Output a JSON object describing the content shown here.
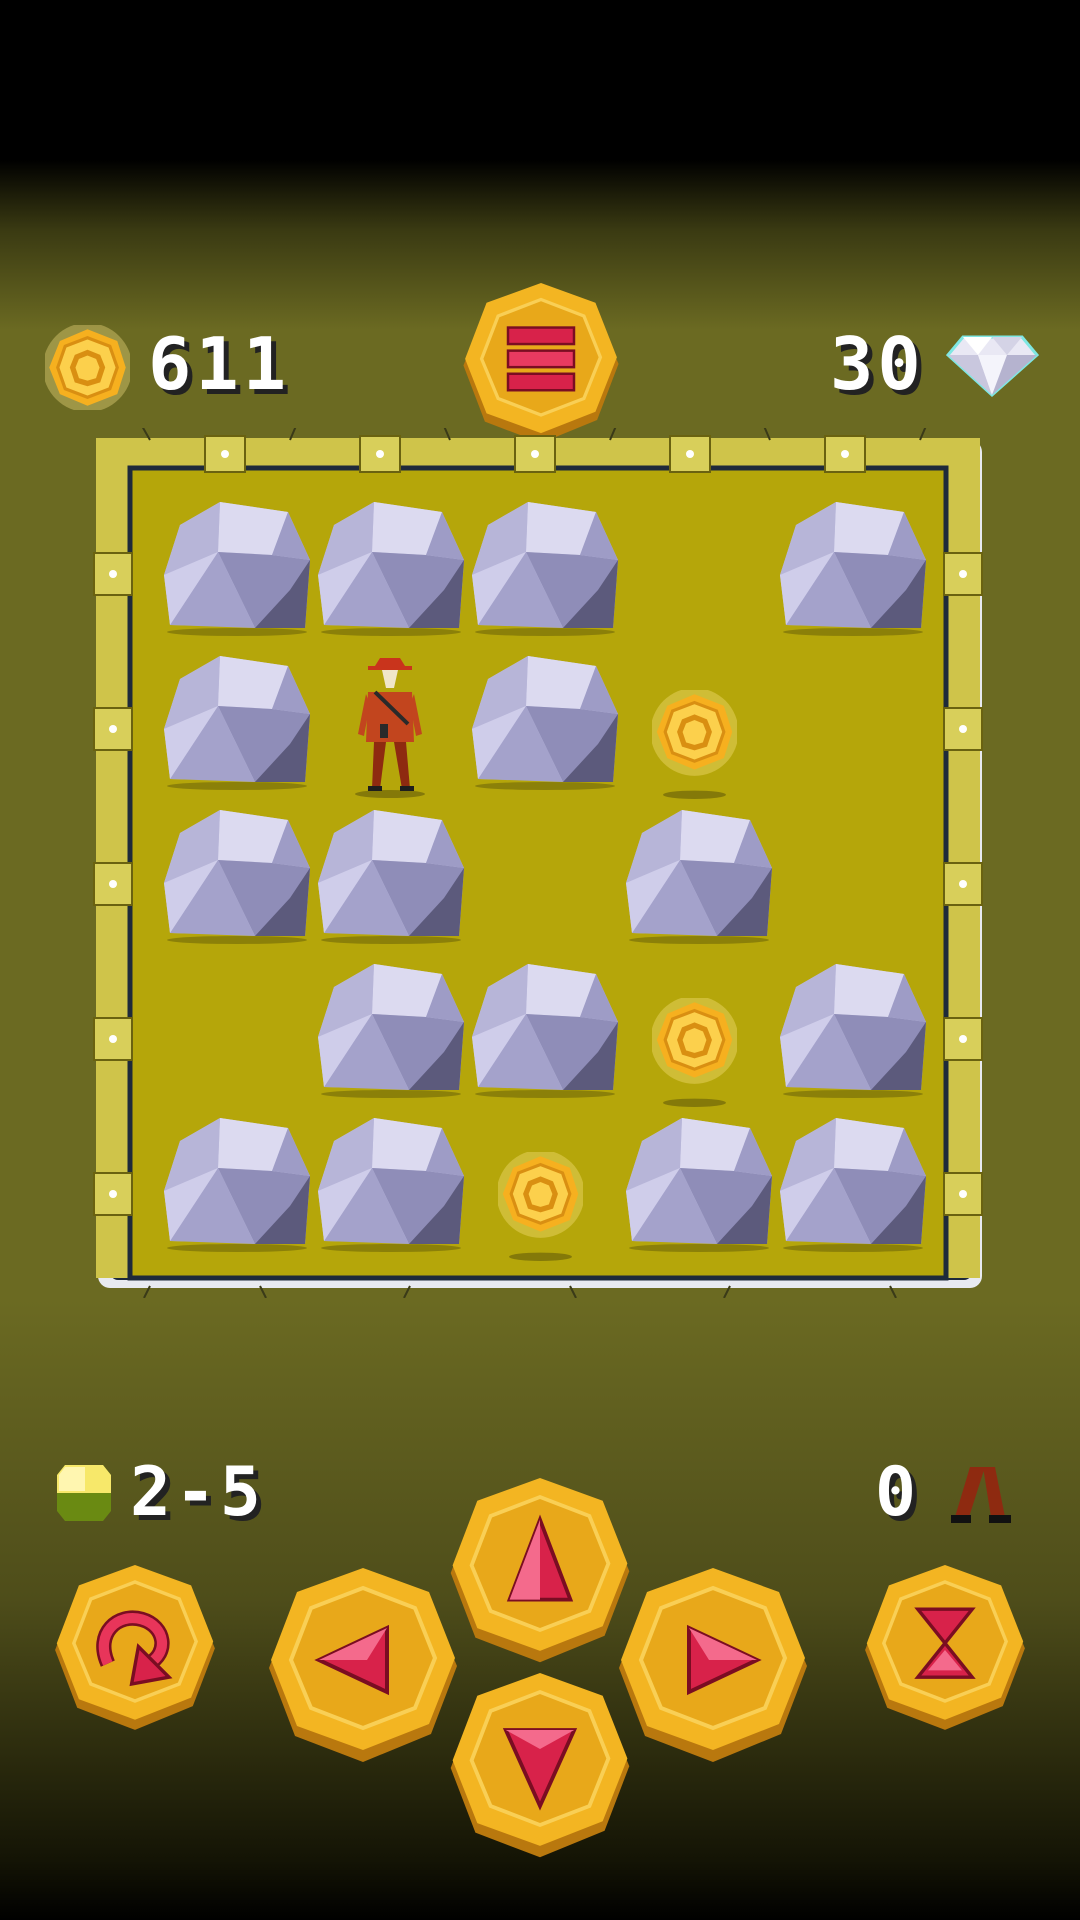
{
  "hud": {
    "coins": "611",
    "gems": "30",
    "level": "2-5",
    "steps": "0",
    "coin_icon": "coin-icon",
    "gem_icon": "diamond-icon",
    "menu_icon": "menu-icon"
  },
  "board": {
    "rows": [
      [
        "rock",
        "rock",
        "rock",
        "empty",
        "rock"
      ],
      [
        "rock",
        "player",
        "rock",
        "coin",
        "empty"
      ],
      [
        "rock",
        "rock",
        "empty",
        "rock",
        "empty"
      ],
      [
        "empty",
        "rock",
        "rock",
        "coin",
        "rock"
      ],
      [
        "rock",
        "rock",
        "coin",
        "rock",
        "rock"
      ]
    ]
  },
  "controls": {
    "undo": "undo-icon",
    "up": "arrow-up-icon",
    "left": "arrow-left-icon",
    "right": "arrow-right-icon",
    "down": "arrow-down-icon",
    "wait": "hourglass-icon"
  },
  "colors": {
    "gold": "#f2b21f",
    "gold_dark": "#c9880f",
    "ruby": "#d8224a",
    "board": "#b5a60a",
    "rock": "#a9a6cf"
  }
}
